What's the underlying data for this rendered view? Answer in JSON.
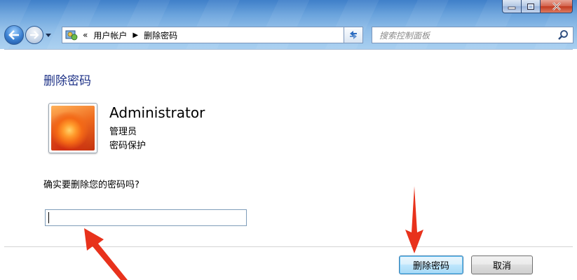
{
  "window": {
    "controls": {
      "minimize": "minimize",
      "maximize": "maximize",
      "close": "close"
    }
  },
  "nav": {
    "breadcrumb_overflow": "«",
    "breadcrumb": [
      "用户帐户",
      "删除密码"
    ],
    "search_placeholder": "搜索控制面板"
  },
  "page": {
    "title": "删除密码",
    "user": {
      "name": "Administrator",
      "role": "管理员",
      "status": "密码保护"
    },
    "confirm_prompt": "确实要删除您的密码吗?",
    "password_value": ""
  },
  "buttons": {
    "delete_label": "删除密码",
    "cancel_label": "取消"
  },
  "colors": {
    "title_blue": "#1e3287",
    "annotation_arrow": "#e8321c"
  },
  "icons": {
    "back": "back-arrow-icon",
    "forward": "forward-arrow-icon",
    "control_panel": "control-panel-icon",
    "search": "search-icon",
    "refresh": "refresh-icon"
  }
}
